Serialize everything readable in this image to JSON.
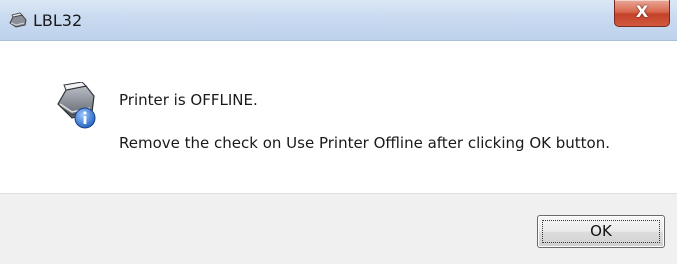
{
  "window": {
    "title": "LBL32",
    "close_label": "X"
  },
  "message": {
    "line1": "Printer is OFFLINE.",
    "line2": "Remove the check on Use Printer Offline after clicking OK button."
  },
  "buttons": {
    "ok_label": "OK"
  },
  "icons": {
    "app": "printer-app-icon",
    "message": "printer-info-icon",
    "close": "close-icon"
  },
  "colors": {
    "titlebar": "#c9daf0",
    "close_button": "#c4422a",
    "footer": "#f0f0f0",
    "info_blue": "#1e5fbf"
  }
}
